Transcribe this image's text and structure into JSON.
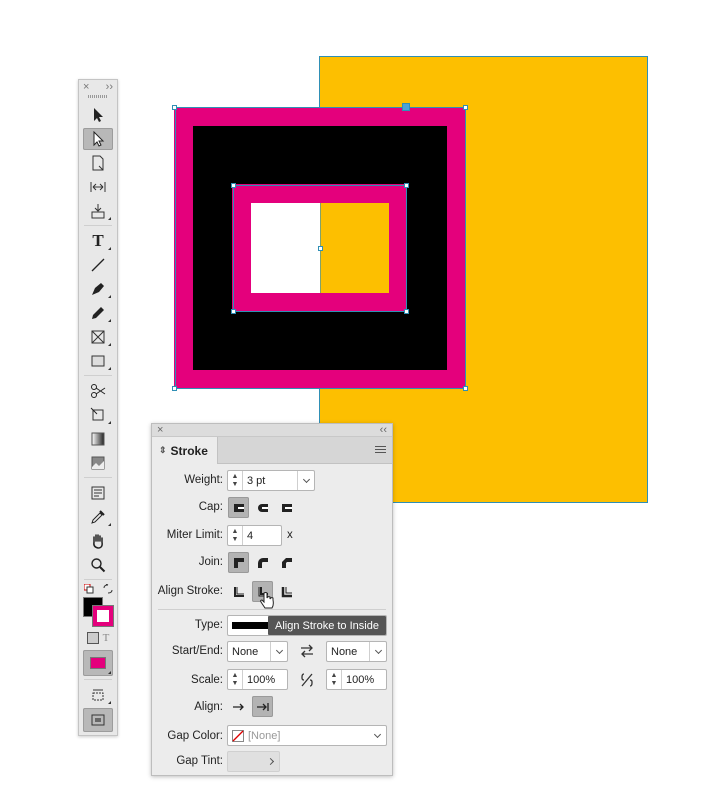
{
  "colors": {
    "page_yellow": "#fdbf00",
    "magenta": "#e4007c",
    "black": "#000000",
    "selection_blue": "#2f8fb5"
  },
  "toolbox": {
    "close_glyph": "×",
    "collapse_glyph": "››",
    "text_tool_label": "T",
    "format_text_glyph": "T",
    "tools": [
      "selection-tool",
      "direct-selection-tool",
      "page-tool",
      "gap-tool",
      "content-collector-tool",
      "type-tool",
      "line-tool",
      "pen-tool",
      "pencil-tool",
      "rectangle-frame-tool",
      "rectangle-tool",
      "scissors-tool",
      "free-transform-tool",
      "gradient-swatch-tool",
      "gradient-feather-tool",
      "note-tool",
      "eyedropper-tool",
      "hand-tool",
      "zoom-tool"
    ]
  },
  "stroke_panel": {
    "close_glyph": "×",
    "collapse_glyph": "‹‹",
    "tab_label": "Stroke",
    "weight_label": "Weight:",
    "weight_value": "3 pt",
    "cap_label": "Cap:",
    "miter_label": "Miter Limit:",
    "miter_value": "4",
    "miter_unit": "x",
    "join_label": "Join:",
    "align_stroke_label": "Align Stroke:",
    "type_label": "Type:",
    "start_end_label": "Start/End:",
    "start_value": "None",
    "end_value": "None",
    "scale_label": "Scale:",
    "scale_start": "100%",
    "scale_end": "100%",
    "align_label": "Align:",
    "gap_color_label": "Gap Color:",
    "gap_color_value": "[None]",
    "gap_tint_label": "Gap Tint:"
  },
  "tooltip": "Align Stroke to Inside"
}
